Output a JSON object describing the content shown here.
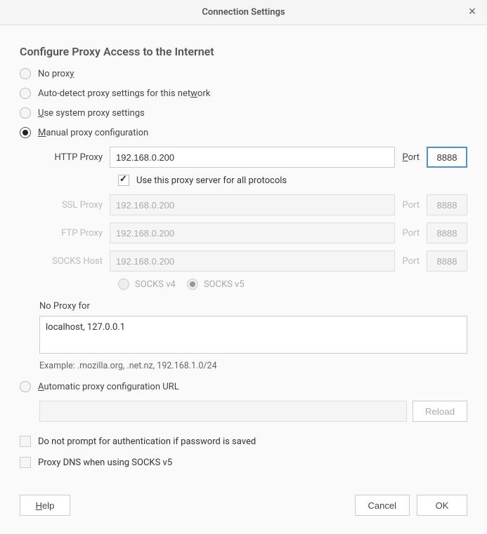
{
  "titlebar": {
    "title": "Connection Settings"
  },
  "heading": "Configure Proxy Access to the Internet",
  "radios": {
    "no_proxy": "No prox",
    "no_proxy_u": "y",
    "autodetect": "Auto-detect proxy settings for this net",
    "autodetect_u": "w",
    "autodetect_tail": "ork",
    "system_u": "U",
    "system": "se system proxy settings",
    "manual_u": "M",
    "manual": "anual proxy configuration",
    "autoconfig_u": "A",
    "autoconfig": "utomatic proxy configuration URL"
  },
  "proxy": {
    "http_label_pre": "HTTP Pro",
    "http_label_u": "x",
    "http_label_post": "y",
    "http_host": "192.168.0.200",
    "http_port": "8888",
    "use_all_u": "U",
    "use_all": "se this proxy server for all protocols",
    "ssl_label_pre": "SS",
    "ssl_label_u": "L",
    "ssl_label_post": " Proxy",
    "ssl_host": "192.168.0.200",
    "ssl_port": "8888",
    "ftp_label_u": "F",
    "ftp_label": "TP Proxy",
    "ftp_host": "192.168.0.200",
    "ftp_port": "8888",
    "socks_label_pre": "SO",
    "socks_label_u": "C",
    "socks_label_post": "KS Host",
    "socks_host": "192.168.0.200",
    "socks_port": "8888",
    "port_label_u": "P",
    "port_label": "ort",
    "port_label_plain": "Port",
    "socks_v4": "SOCKS v4",
    "socks_v5_pre": "SOCKS v",
    "socks_v5_u": "5"
  },
  "noproxy": {
    "label_u": "N",
    "label": "o Proxy for",
    "value": "localhost, 127.0.0.1",
    "example": "Example: .mozilla.org, .net.nz, 192.168.1.0/24"
  },
  "autoconfig": {
    "reload_u": "R",
    "reload": "eload"
  },
  "checks": {
    "no_prompt_pre": "Do not prompt for authentication ",
    "no_prompt_u": "i",
    "no_prompt_post": "f password is saved",
    "proxy_dns_pre": "Proxy ",
    "proxy_dns_u": "D",
    "proxy_dns_post": "NS when using SOCKS v5"
  },
  "footer": {
    "help_u": "H",
    "help": "elp",
    "cancel": "Cancel",
    "ok": "OK"
  }
}
